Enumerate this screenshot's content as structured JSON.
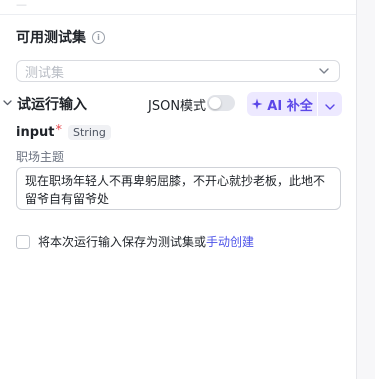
{
  "header": {
    "faded_text": "—"
  },
  "test_set": {
    "title": "可用测试集",
    "info_icon": "info-circle-icon",
    "select_placeholder": "测试集"
  },
  "trial_run": {
    "title": "试运行输入",
    "json_mode_label": "JSON模式",
    "json_mode_enabled": false,
    "ai_button_label": "AI 补全",
    "accent_color": "#5b47e8"
  },
  "input": {
    "name": "input",
    "required_mark": "*",
    "type": "String",
    "description": "职场主题",
    "value": "现在职场年轻人不再卑躬屈膝，不开心就抄老板，此地不留爷自有留爷处"
  },
  "save": {
    "checked": false,
    "text": "将本次运行输入保存为测试集或",
    "link_text": "手动创建",
    "link_color": "#4d53e8"
  }
}
